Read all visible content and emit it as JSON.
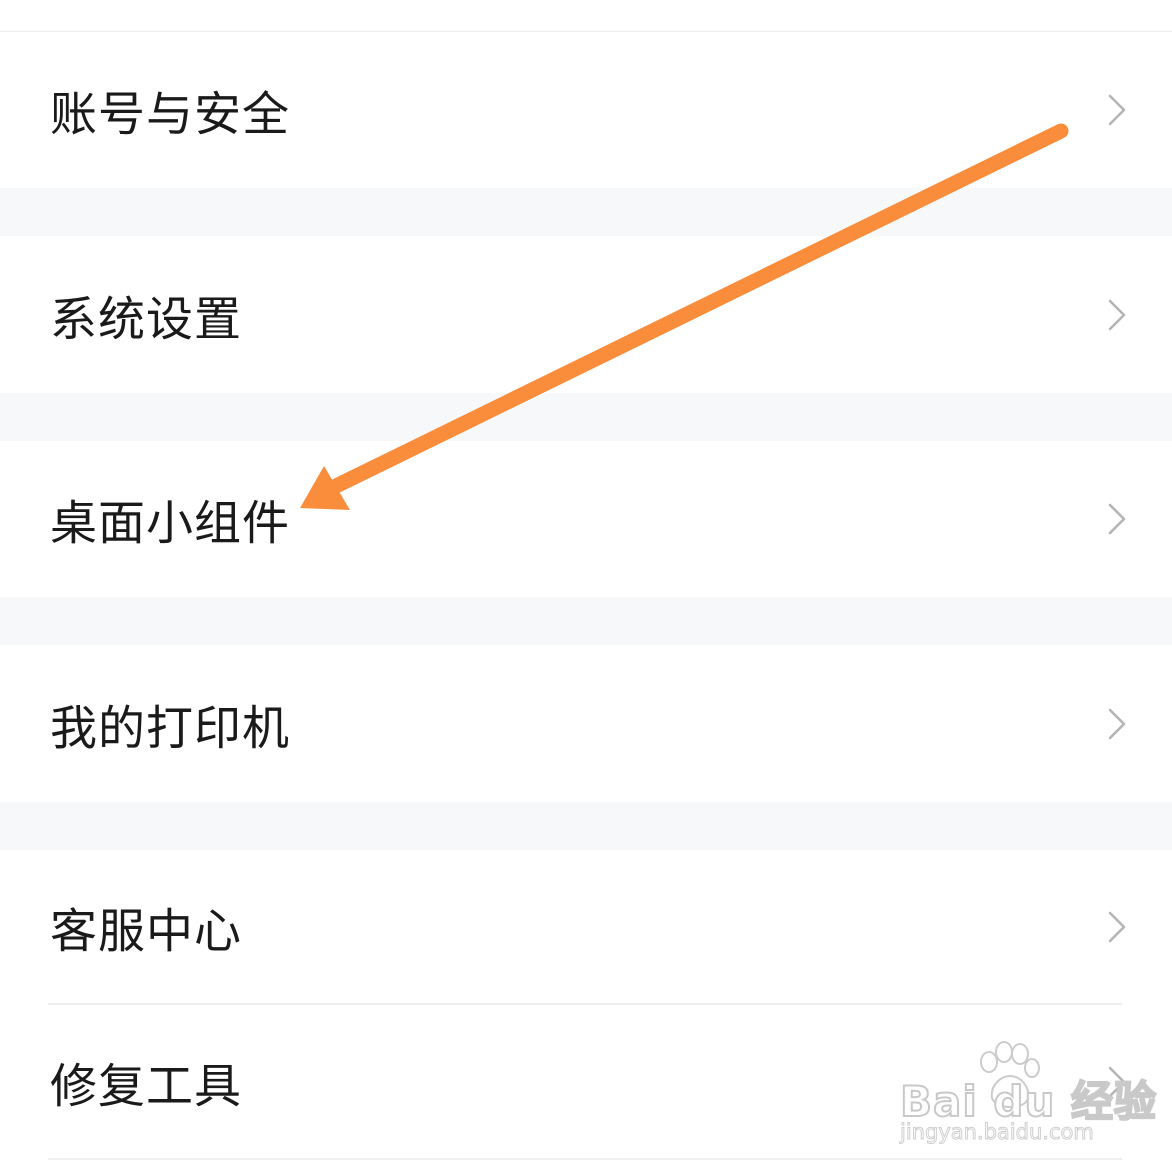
{
  "menu": {
    "items": [
      {
        "label": "账号与安全"
      },
      {
        "label": "系统设置"
      },
      {
        "label": "桌面小组件"
      },
      {
        "label": "我的打印机"
      },
      {
        "label": "客服中心"
      },
      {
        "label": "修复工具"
      }
    ]
  },
  "annotation": {
    "arrow_color": "#f98d3c",
    "points_to": "桌面小组件"
  },
  "watermark": {
    "brand": "Bai du 经验",
    "url": "jingyan.baidu.com"
  },
  "colors": {
    "background": "#ffffff",
    "section_gap": "#f7f8fa",
    "text": "#1a1a1a",
    "chevron": "#b5b5b5",
    "arrow": "#f98d3c"
  }
}
